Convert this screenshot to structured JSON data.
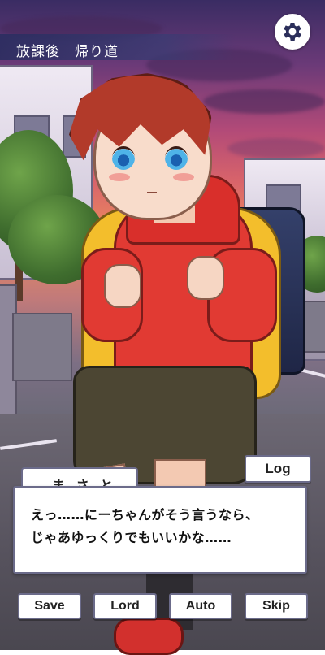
{
  "scene": {
    "location": "放課後　帰り道",
    "time_of_day": "sunset"
  },
  "colors": {
    "ui_border": "#6b6b8a",
    "location_bar": "#2d3160",
    "text": "#111111"
  },
  "character": {
    "hair": "#b23a2a",
    "hoodie": "#e13a33",
    "jacket": "#f3be2c",
    "eyes": "#4fb3e8"
  },
  "dialog": {
    "speaker": "ま さ と",
    "lines": [
      "えっ……にーちゃんがそう言うなら、",
      "じゃあゆっくりでもいいかな……"
    ]
  },
  "buttons": {
    "log": "Log",
    "save": "Save",
    "load": "Lord",
    "auto": "Auto",
    "skip": "Skip"
  },
  "icons": {
    "settings": "gear-icon"
  }
}
